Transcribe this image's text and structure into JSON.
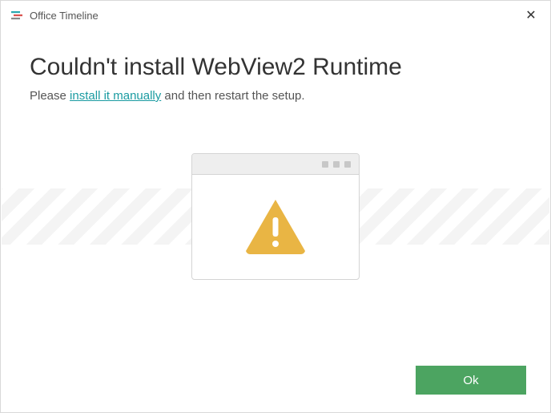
{
  "titlebar": {
    "app_name": "Office Timeline",
    "close_symbol": "✕"
  },
  "content": {
    "heading": "Couldn't install WebView2 Runtime",
    "subtext_prefix": "Please ",
    "subtext_link": "install it manually",
    "subtext_suffix": " and then restart the setup."
  },
  "footer": {
    "ok_label": "Ok"
  }
}
